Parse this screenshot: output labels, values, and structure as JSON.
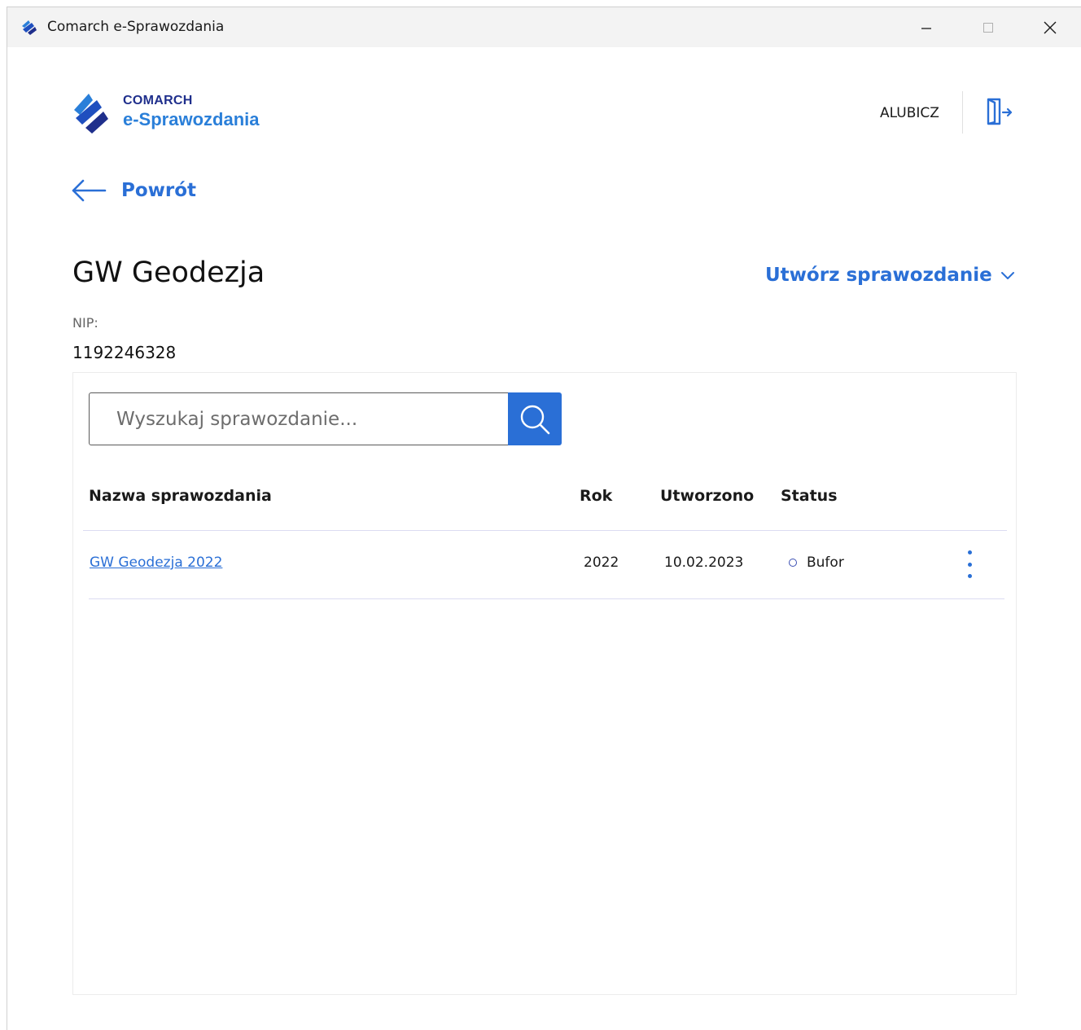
{
  "window": {
    "title": "Comarch e-Sprawozdania",
    "controls": [
      "minimize-icon",
      "maximize-icon",
      "close-icon"
    ]
  },
  "header": {
    "brand_top": "COMARCH",
    "brand_bottom": "e-Sprawozdania",
    "user": "ALUBICZ",
    "logout_icon": "logout-icon"
  },
  "nav": {
    "back_label": "Powrót"
  },
  "company": {
    "name": "GW Geodezja",
    "nip_label": "NIP:",
    "nip_value": "1192246328",
    "create_label": "Utwórz sprawozdanie"
  },
  "search": {
    "placeholder": "Wyszukaj sprawozdanie...",
    "value": ""
  },
  "table": {
    "headers": {
      "name": "Nazwa sprawozdania",
      "year": "Rok",
      "created": "Utworzono",
      "status": "Status"
    },
    "rows": [
      {
        "name": "GW Geodezja 2022",
        "year": "2022",
        "created": "10.02.2023",
        "status": "Bufor"
      }
    ]
  },
  "colors": {
    "accent": "#2a6fd6",
    "brand_dark": "#1f2f8c",
    "brand_light": "#2a7fd9",
    "status_dot": "#3b4fb3"
  }
}
